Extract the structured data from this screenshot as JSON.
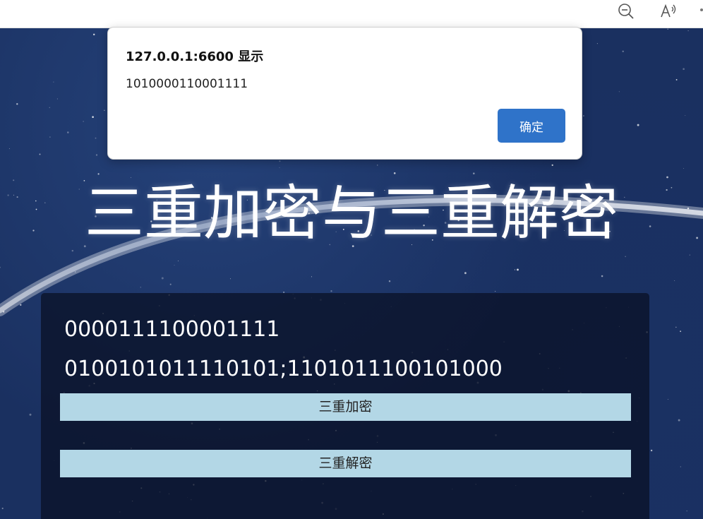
{
  "browser": {
    "toolbar_icons": [
      "zoom-out-icon",
      "read-aloud-icon"
    ]
  },
  "page": {
    "title": "三重加密与三重解密",
    "lines": [
      "0000111100001111",
      "0100101011110101;1101011100101000"
    ],
    "buttons": {
      "encrypt": "三重加密",
      "decrypt": "三重解密"
    },
    "colors": {
      "background": "#1a3060",
      "button": "#b3d7e6"
    }
  },
  "alert": {
    "title": "127.0.0.1:6600 显示",
    "message": "1010000110001111",
    "ok_label": "确定",
    "ok_color": "#2f73c9"
  }
}
